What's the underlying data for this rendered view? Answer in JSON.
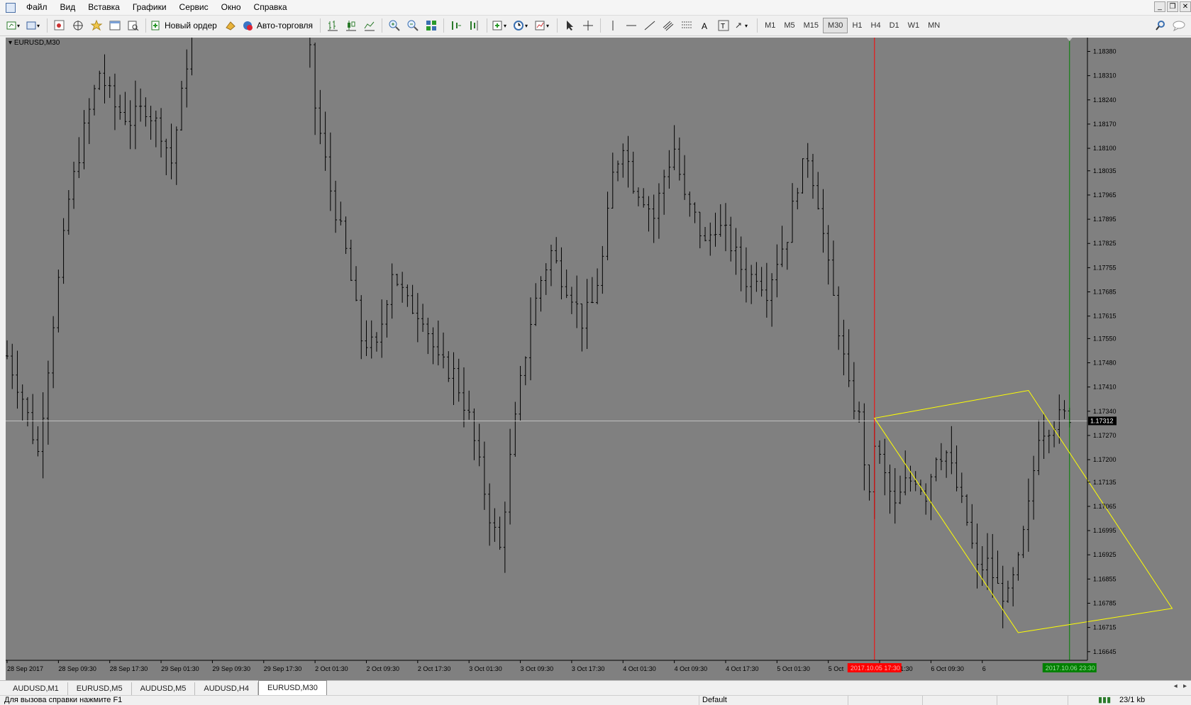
{
  "menu": {
    "items": [
      "Файл",
      "Вид",
      "Вставка",
      "Графики",
      "Сервис",
      "Окно",
      "Справка"
    ]
  },
  "toolbar": {
    "new_order_label": "Новый ордер",
    "auto_trading_label": "Авто-торговля",
    "timeframes": [
      "M1",
      "M5",
      "M15",
      "M30",
      "H1",
      "H4",
      "D1",
      "W1",
      "MN"
    ],
    "active_timeframe": "M30"
  },
  "chart": {
    "title": "EURUSD,M30",
    "current_price": "1.17312",
    "price_axis_labels": [
      "1.18380",
      "1.18310",
      "1.18240",
      "1.18170",
      "1.18100",
      "1.18035",
      "1.17965",
      "1.17895",
      "1.17825",
      "1.17755",
      "1.17685",
      "1.17615",
      "1.17550",
      "1.17480",
      "1.17410",
      "1.17340",
      "1.17270",
      "1.17200",
      "1.17135",
      "1.17065",
      "1.16995",
      "1.16925",
      "1.16855",
      "1.16785",
      "1.16715",
      "1.16645"
    ],
    "time_axis_labels": [
      "28 Sep 2017",
      "28 Sep 09:30",
      "28 Sep 17:30",
      "29 Sep 01:30",
      "29 Sep 09:30",
      "29 Sep 17:30",
      "2 Oct 01:30",
      "2 Oct 09:30",
      "2 Oct 17:30",
      "3 Oct 01:30",
      "3 Oct 09:30",
      "3 Oct 17:30",
      "4 Oct 01:30",
      "4 Oct 09:30",
      "4 Oct 17:30",
      "5 Oct 01:30",
      "5 Oct",
      "6 Oct 01:30",
      "6 Oct 09:30",
      "6"
    ],
    "red_line_label": "2017.10.05 17:30",
    "green_line_label": "2017.10.06 23:30",
    "colors": {
      "background": "#808080",
      "bars": "#000000",
      "bid_line": "#c0c0c0",
      "vline_start": "#ff0000",
      "vline_end": "#008000",
      "channel": "#ffff00",
      "axis_text": "#000000"
    }
  },
  "chart_data": {
    "type": "bar",
    "title": "EURUSD,M30",
    "xlabel": "",
    "ylabel": "",
    "ylim": [
      1.1662,
      1.1842
    ],
    "grid": false,
    "close_path": [
      [
        0,
        1.175
      ],
      [
        3,
        1.1738
      ],
      [
        6,
        1.1722
      ],
      [
        9,
        1.176
      ],
      [
        12,
        1.1795
      ],
      [
        15,
        1.1815
      ],
      [
        18,
        1.1832
      ],
      [
        21,
        1.1822
      ],
      [
        24,
        1.1818
      ],
      [
        27,
        1.1822
      ],
      [
        30,
        1.1815
      ],
      [
        32,
        1.1806
      ],
      [
        34,
        1.1825
      ],
      [
        36,
        1.1845
      ],
      [
        38,
        1.1868
      ],
      [
        40,
        1.1882
      ],
      [
        43,
        1.1876
      ],
      [
        46,
        1.187
      ],
      [
        49,
        1.1855
      ],
      [
        52,
        1.1875
      ],
      [
        54,
        1.1895
      ],
      [
        57,
        1.1867
      ],
      [
        60,
        1.1822
      ],
      [
        63,
        1.1798
      ],
      [
        66,
        1.178
      ],
      [
        69,
        1.1755
      ],
      [
        72,
        1.1752
      ],
      [
        75,
        1.1775
      ],
      [
        78,
        1.1765
      ],
      [
        81,
        1.1762
      ],
      [
        84,
        1.1748
      ],
      [
        87,
        1.1745
      ],
      [
        90,
        1.1732
      ],
      [
        92,
        1.1718
      ],
      [
        94,
        1.1704
      ],
      [
        96,
        1.1694
      ],
      [
        98,
        1.172
      ],
      [
        100,
        1.1742
      ],
      [
        102,
        1.176
      ],
      [
        104,
        1.1772
      ],
      [
        106,
        1.178
      ],
      [
        108,
        1.1773
      ],
      [
        110,
        1.1768
      ],
      [
        112,
        1.176
      ],
      [
        114,
        1.1765
      ],
      [
        116,
        1.1778
      ],
      [
        118,
        1.1802
      ],
      [
        120,
        1.1812
      ],
      [
        122,
        1.18
      ],
      [
        124,
        1.1796
      ],
      [
        126,
        1.179
      ],
      [
        128,
        1.1802
      ],
      [
        130,
        1.181
      ],
      [
        132,
        1.1795
      ],
      [
        134,
        1.179
      ],
      [
        136,
        1.1782
      ],
      [
        138,
        1.1788
      ],
      [
        140,
        1.1785
      ],
      [
        142,
        1.1779
      ],
      [
        144,
        1.1772
      ],
      [
        146,
        1.1774
      ],
      [
        148,
        1.1769
      ],
      [
        150,
        1.1778
      ],
      [
        152,
        1.1785
      ],
      [
        154,
        1.18
      ],
      [
        156,
        1.1808
      ],
      [
        158,
        1.1795
      ],
      [
        160,
        1.1775
      ],
      [
        162,
        1.1758
      ],
      [
        164,
        1.174
      ],
      [
        166,
        1.1732
      ],
      [
        168,
        1.1708
      ],
      [
        169,
        1.1725
      ],
      [
        171,
        1.1715
      ],
      [
        173,
        1.1706
      ],
      [
        175,
        1.1713
      ],
      [
        177,
        1.1715
      ],
      [
        179,
        1.171
      ],
      [
        181,
        1.1722
      ],
      [
        183,
        1.1722
      ],
      [
        185,
        1.1712
      ],
      [
        187,
        1.1702
      ],
      [
        189,
        1.1688
      ],
      [
        191,
        1.169
      ],
      [
        193,
        1.1683
      ],
      [
        195,
        1.168
      ],
      [
        197,
        1.169
      ],
      [
        199,
        1.1706
      ],
      [
        201,
        1.1728
      ],
      [
        203,
        1.173
      ],
      [
        205,
        1.1732
      ],
      [
        207,
        1.1733
      ]
    ],
    "bar_count": 208,
    "channel_points": [
      [
        169,
        1.1732
      ],
      [
        199,
        1.174
      ],
      [
        227,
        1.1677
      ],
      [
        197,
        1.167
      ]
    ],
    "vlines": {
      "start_index": 169,
      "end_index": 207
    },
    "current_price": 1.17312
  }
}
